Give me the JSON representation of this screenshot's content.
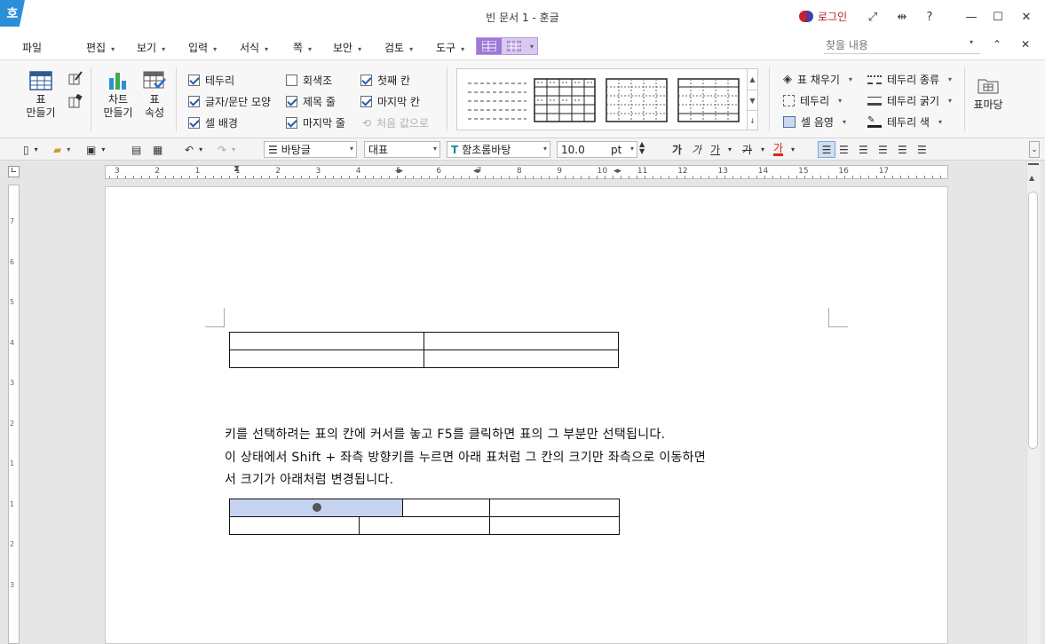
{
  "app": {
    "icon_glyph": "호",
    "title": "빈 문서 1 - 훈글",
    "login": "로그인"
  },
  "window_controls": {
    "fullscreen": "⤢",
    "split": "⇹",
    "help": "?",
    "minimize": "—",
    "maximize": "☐",
    "close": "✕"
  },
  "menu": [
    {
      "label": "파일",
      "arrow": ""
    },
    {
      "label": "편집",
      "arrow": "▾"
    },
    {
      "label": "보기",
      "arrow": "▾"
    },
    {
      "label": "입력",
      "arrow": "▾"
    },
    {
      "label": "서식",
      "arrow": "▾"
    },
    {
      "label": "쪽",
      "arrow": "▾"
    },
    {
      "label": "보안",
      "arrow": "▾"
    },
    {
      "label": "검토",
      "arrow": "▾"
    },
    {
      "label": "도구",
      "arrow": "▾"
    }
  ],
  "search": {
    "placeholder": "찾을 내용"
  },
  "ribbon": {
    "table_make": "표\n만들기",
    "chart_make": "차트\n만들기",
    "table_props": "표\n속성",
    "checks_col1": [
      {
        "label": "테두리",
        "checked": true,
        "disabled": false
      },
      {
        "label": "글자/문단 모양",
        "checked": true,
        "disabled": false
      },
      {
        "label": "셀 배경",
        "checked": true,
        "disabled": false
      }
    ],
    "checks_col2": [
      {
        "label": "회색조",
        "checked": false,
        "disabled": false
      },
      {
        "label": "제목 줄",
        "checked": true,
        "disabled": false
      },
      {
        "label": "마지막 줄",
        "checked": true,
        "disabled": false
      }
    ],
    "checks_col3": [
      {
        "label": "첫째 칸",
        "checked": true,
        "disabled": false
      },
      {
        "label": "마지막 칸",
        "checked": true,
        "disabled": false
      },
      {
        "label": "처음 값으로",
        "checked": false,
        "disabled": true
      }
    ],
    "fill_options": [
      {
        "label": "표 채우기",
        "icon": "paint-bucket-icon"
      },
      {
        "label": "테두리",
        "icon": "border-icon"
      },
      {
        "label": "셀 음영",
        "icon": "cell-shade-icon"
      }
    ],
    "border_options": [
      {
        "label": "테두리 종류",
        "icon": "border-style-icon"
      },
      {
        "label": "테두리 굵기",
        "icon": "border-weight-icon"
      },
      {
        "label": "테두리 색",
        "icon": "border-color-icon"
      }
    ],
    "table_madang": "표마당"
  },
  "format_bar": {
    "style": "바탕글",
    "lang": "대표",
    "font": "함초롬바탕",
    "font_icon": "T",
    "size": "10.0",
    "unit": "pt",
    "bold": "가",
    "italic": "가",
    "underline": "가",
    "strike": "가",
    "fontcolor": "가",
    "accent_color": "#e02020"
  },
  "ruler": {
    "h_ticks": [
      "3",
      "2",
      "1",
      "1",
      "2",
      "3",
      "4",
      "5",
      "6",
      "7",
      "8",
      "9",
      "10",
      "11",
      "12",
      "13",
      "14",
      "15",
      "16",
      "17"
    ],
    "v_ticks": [
      "7",
      "6",
      "5",
      "4",
      "3",
      "2",
      "1",
      "1",
      "2",
      "3"
    ]
  },
  "document": {
    "lines": [
      "키를 선택하려는 표의 칸에 커서를 놓고 F5를 클릭하면 표의 그 부분만 선택됩니다.",
      "이 상태에서 Shift + 좌측 방향키를  누르면 아래 표처럼 그 칸의 크기만 좌측으로 이동하면",
      "서 크기가 아래처럼 변경됩니다."
    ],
    "selection_color": "#c6d3f0"
  }
}
